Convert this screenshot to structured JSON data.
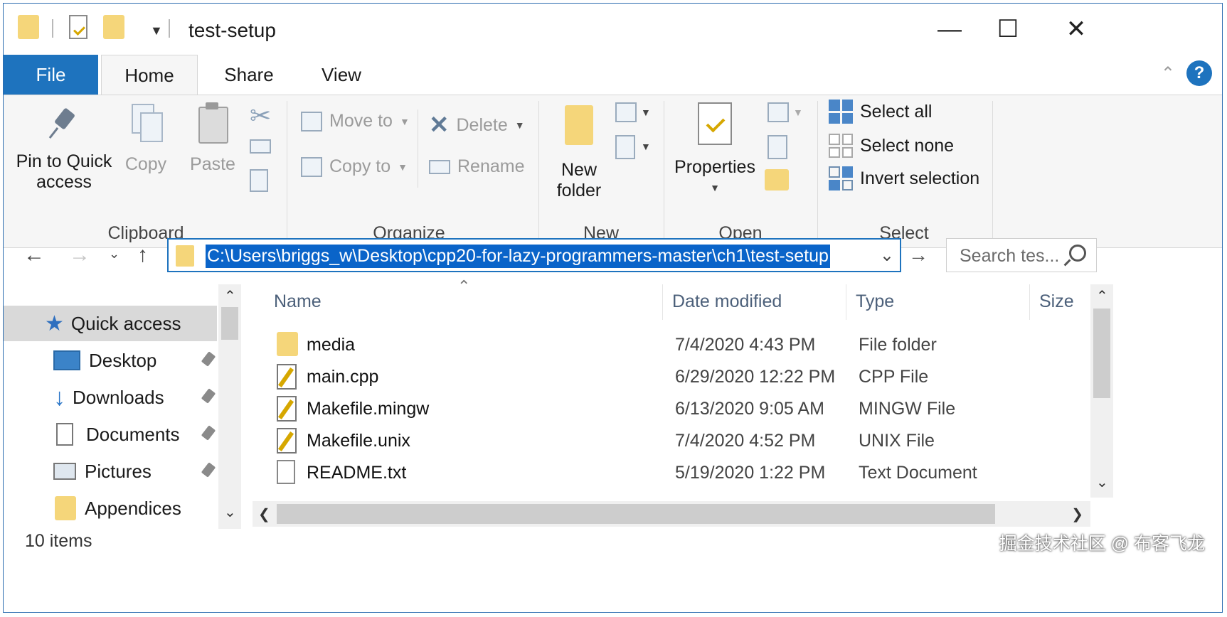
{
  "window": {
    "title": "test-setup"
  },
  "tabs": {
    "file": "File",
    "home": "Home",
    "share": "Share",
    "view": "View"
  },
  "ribbon": {
    "clipboard": {
      "pin": "Pin to Quick access",
      "copy": "Copy",
      "paste": "Paste",
      "label": "Clipboard"
    },
    "organize": {
      "move_to": "Move to",
      "copy_to": "Copy to",
      "delete": "Delete",
      "rename": "Rename",
      "label": "Organize"
    },
    "new": {
      "new_folder": "New folder",
      "label": "New"
    },
    "open": {
      "properties": "Properties",
      "label": "Open"
    },
    "select": {
      "select_all": "Select all",
      "select_none": "Select none",
      "invert": "Invert selection",
      "label": "Select"
    }
  },
  "address": {
    "path": "C:\\Users\\briggs_w\\Desktop\\cpp20-for-lazy-programmers-master\\ch1\\test-setup",
    "search_placeholder": "Search tes..."
  },
  "nav": {
    "items": [
      {
        "label": "Quick access",
        "icon": "star-icon",
        "pinned": false
      },
      {
        "label": "Desktop",
        "icon": "desktop-icon",
        "pinned": true
      },
      {
        "label": "Downloads",
        "icon": "download-icon",
        "pinned": true
      },
      {
        "label": "Documents",
        "icon": "documents-icon",
        "pinned": true
      },
      {
        "label": "Pictures",
        "icon": "pictures-icon",
        "pinned": true
      },
      {
        "label": "Appendices",
        "icon": "folder-icon",
        "pinned": false
      }
    ]
  },
  "columns": {
    "name": "Name",
    "date": "Date modified",
    "type": "Type",
    "size": "Size"
  },
  "files": [
    {
      "name": "media",
      "date": "7/4/2020 4:43 PM",
      "type": "File folder",
      "icon": "folder-icon"
    },
    {
      "name": "main.cpp",
      "date": "6/29/2020 12:22 PM",
      "type": "CPP File",
      "icon": "cpp-file-icon"
    },
    {
      "name": "Makefile.mingw",
      "date": "6/13/2020 9:05 AM",
      "type": "MINGW File",
      "icon": "cpp-file-icon"
    },
    {
      "name": "Makefile.unix",
      "date": "7/4/2020 4:52 PM",
      "type": "UNIX File",
      "icon": "cpp-file-icon"
    },
    {
      "name": "README.txt",
      "date": "5/19/2020 1:22 PM",
      "type": "Text Document",
      "icon": "text-file-icon"
    }
  ],
  "status": {
    "count": "10 items"
  },
  "watermark": "掘金技术社区 @ 布客飞龙"
}
